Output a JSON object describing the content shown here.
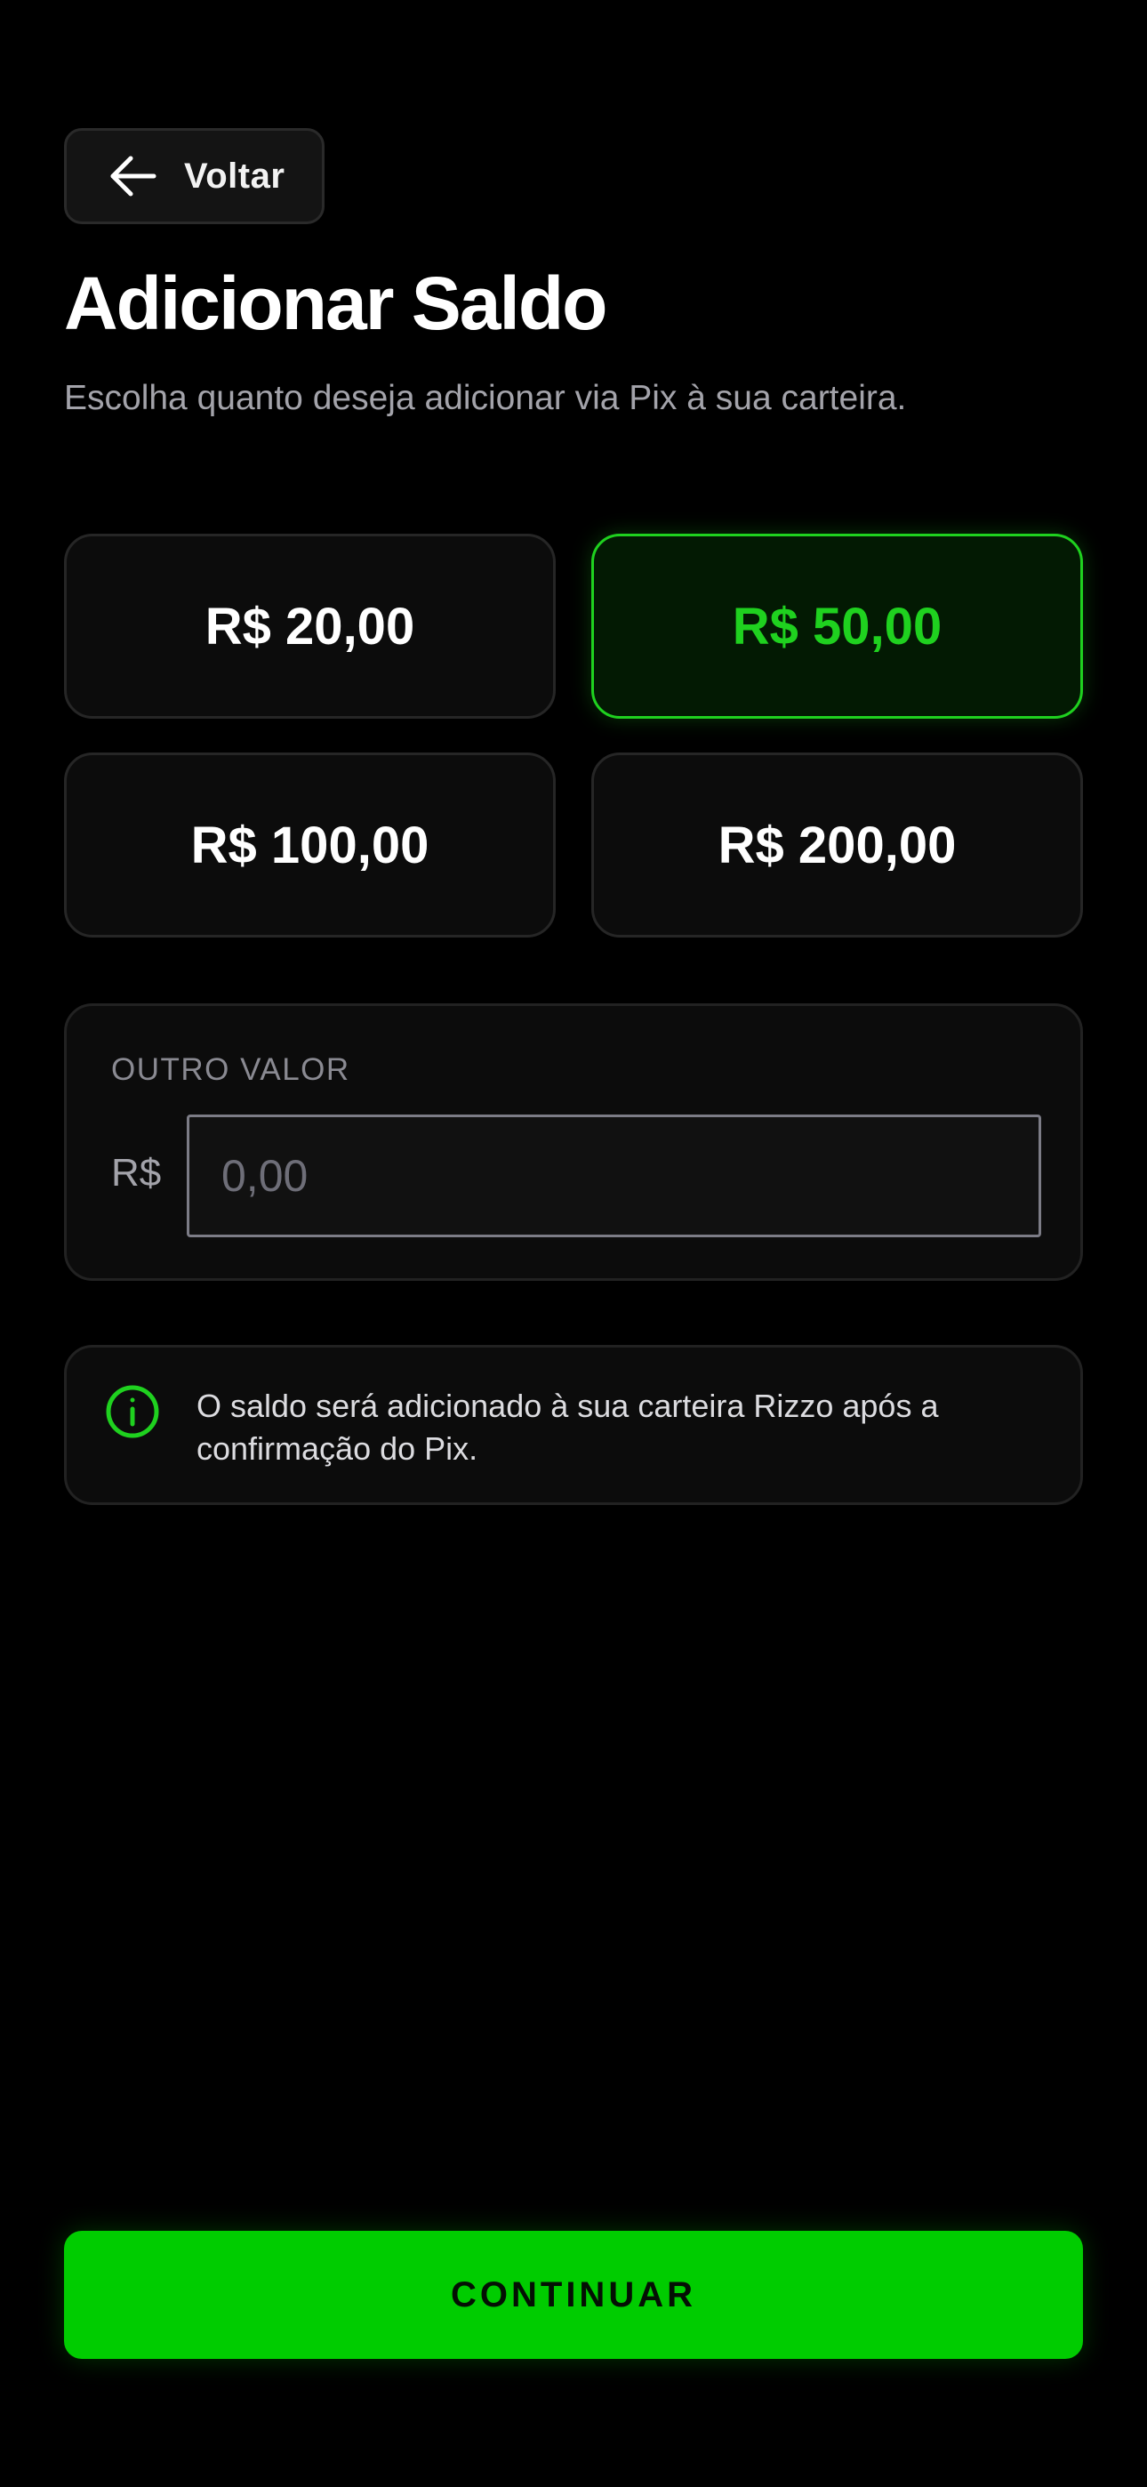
{
  "header": {
    "back_label": "Voltar",
    "back_icon": "arrow-left-icon"
  },
  "title": "Adicionar Saldo",
  "subtitle": "Escolha quanto deseja adicionar via Pix à sua carteira.",
  "amount_options": [
    {
      "label": "R$ 20,00",
      "selected": false
    },
    {
      "label": "R$ 50,00",
      "selected": true
    },
    {
      "label": "R$ 100,00",
      "selected": false
    },
    {
      "label": "R$ 200,00",
      "selected": false
    }
  ],
  "custom_amount": {
    "label": "OUTRO VALOR",
    "currency": "R$",
    "value": "",
    "placeholder": "0,00"
  },
  "info": {
    "icon": "info-circle-icon",
    "text": "O saldo será adicionado à sua carteira Rizzo após a confirmação do Pix."
  },
  "continue_label": "CONTINUAR",
  "colors": {
    "background": "#000000",
    "accent": "#00cc00",
    "selected_border": "#1fd11f",
    "card": "#0c0c0c",
    "muted_text": "#a3a3aa"
  }
}
